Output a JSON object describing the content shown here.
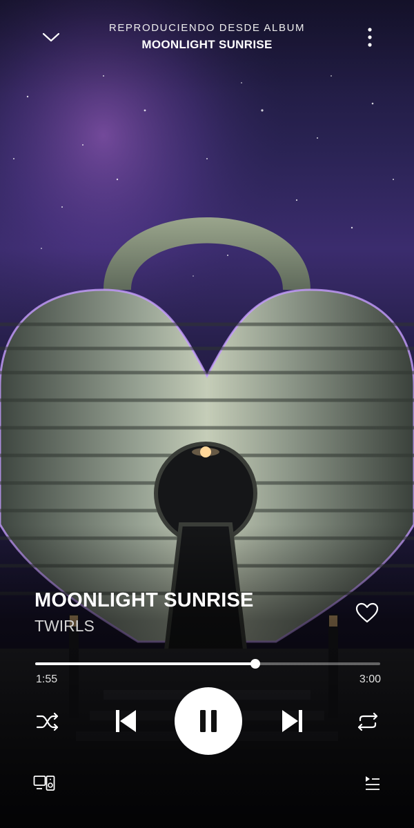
{
  "header": {
    "context_label": "REPRODUCIENDO DESDE ALBUM",
    "context_name": "MOONLIGHT SUNRISE",
    "collapse_icon": "chevron-down-icon",
    "menu_icon": "more-vertical-icon"
  },
  "artwork": {
    "description_icon": "album-artwork"
  },
  "track": {
    "title": "MOONLIGHT SUNRISE",
    "artist": "TWIRLS",
    "liked": false
  },
  "playback": {
    "elapsed": "1:55",
    "duration": "3:00",
    "progress_fraction": 0.638,
    "is_playing": true
  },
  "controls": {
    "shuffle_icon": "shuffle-icon",
    "previous_icon": "skip-previous-icon",
    "pause_icon": "pause-icon",
    "next_icon": "skip-next-icon",
    "repeat_icon": "repeat-icon",
    "devices_icon": "connect-devices-icon",
    "queue_icon": "queue-icon"
  },
  "colors": {
    "accent": "#ffffff",
    "sky_top": "#1a1633",
    "sky_nebula": "#6a3fa0",
    "heart_metal": "#8a9484",
    "heart_glow": "#c69cff"
  }
}
